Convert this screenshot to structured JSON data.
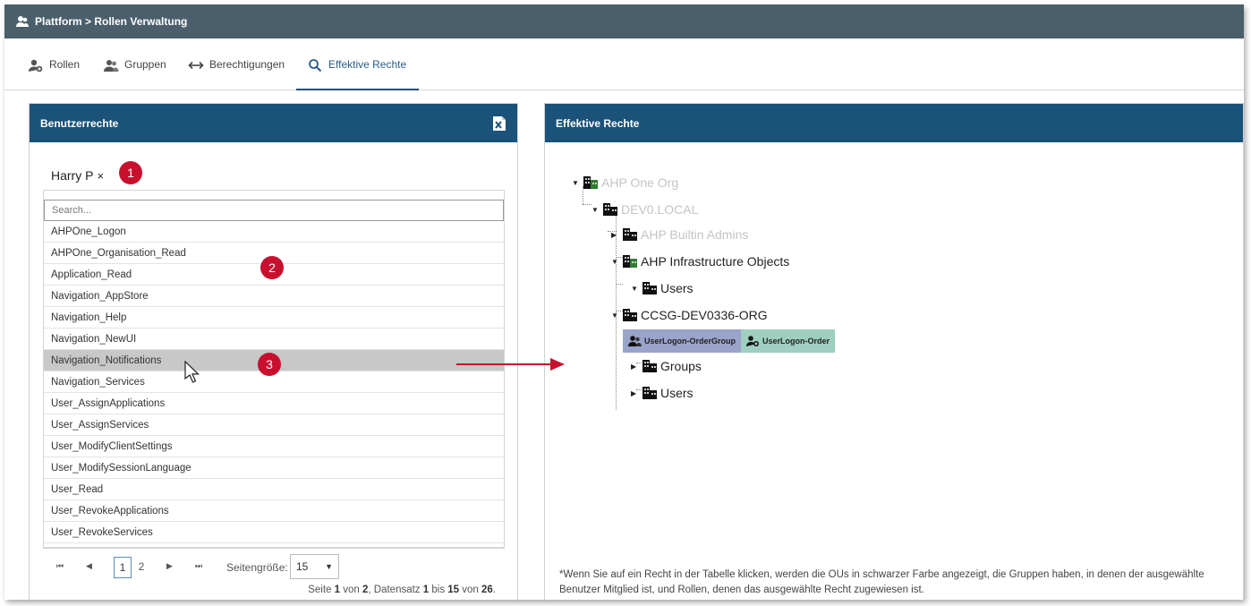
{
  "titlebar": {
    "title": "Plattform > Rollen Verwaltung"
  },
  "tabs": [
    {
      "label": "Rollen",
      "icon": "user-add-icon"
    },
    {
      "label": "Gruppen",
      "icon": "group-icon"
    },
    {
      "label": "Berechtigungen",
      "icon": "swap-arrows-icon"
    },
    {
      "label": "Effektive Rechte",
      "icon": "search-icon",
      "active": true
    }
  ],
  "left_panel": {
    "title": "Benutzerrechte",
    "selected_user": "Harry P",
    "remove_symbol": "×",
    "search_placeholder": "Search...",
    "items": [
      "AHPOne_Logon",
      "AHPOne_Organisation_Read",
      "Application_Read",
      "Navigation_AppStore",
      "Navigation_Help",
      "Navigation_NewUI",
      "Navigation_Notifications",
      "Navigation_Services",
      "User_AssignApplications",
      "User_AssignServices",
      "User_ModifyClientSettings",
      "User_ModifySessionLanguage",
      "User_Read",
      "User_RevokeApplications",
      "User_RevokeServices"
    ],
    "selected_index": 6,
    "pager": {
      "pages": [
        "1",
        "2"
      ],
      "current_page": "1",
      "page_size_label": "Seitengröße:",
      "page_size": "15",
      "info": {
        "p1": "Seite ",
        "page": "1",
        "p2": " von ",
        "pages": "2",
        "p3": ", Datensatz ",
        "from": "1",
        "p4": " bis ",
        "to": "15",
        "p5": " von ",
        "total": "26",
        "p6": "."
      }
    }
  },
  "badges": [
    "1",
    "2",
    "3"
  ],
  "right_panel": {
    "title": "Effektive Rechte",
    "tree": {
      "root": "AHP One Org",
      "domain": "DEV0.LOCAL",
      "builtin": "AHP Builtin Admins",
      "infra": "AHP Infrastructure Objects",
      "infra_users": "Users",
      "ccsg": "CCSG-DEV0336-ORG",
      "ccsg_groups": "Groups",
      "ccsg_users": "Users"
    },
    "tags": [
      {
        "label": "UserLogon-OrderGroup",
        "color": "#9aa3c9",
        "icon": "group-icon"
      },
      {
        "label": "UserLogon-Order",
        "color": "#9ecfc1",
        "icon": "user-add-icon"
      }
    ],
    "footnote": "*Wenn Sie auf ein Recht in der Tabelle klicken, werden die OUs in schwarzer Farbe angezeigt, die Gruppen haben, in denen der ausgewählte Benutzer Mitglied ist, und Rollen, denen das ausgewählte Recht zugewiesen ist."
  },
  "colors": {
    "header": "#4b5e6b",
    "panel_head": "#1a5279",
    "badge": "#c8102e",
    "arrow": "#c8102e"
  }
}
